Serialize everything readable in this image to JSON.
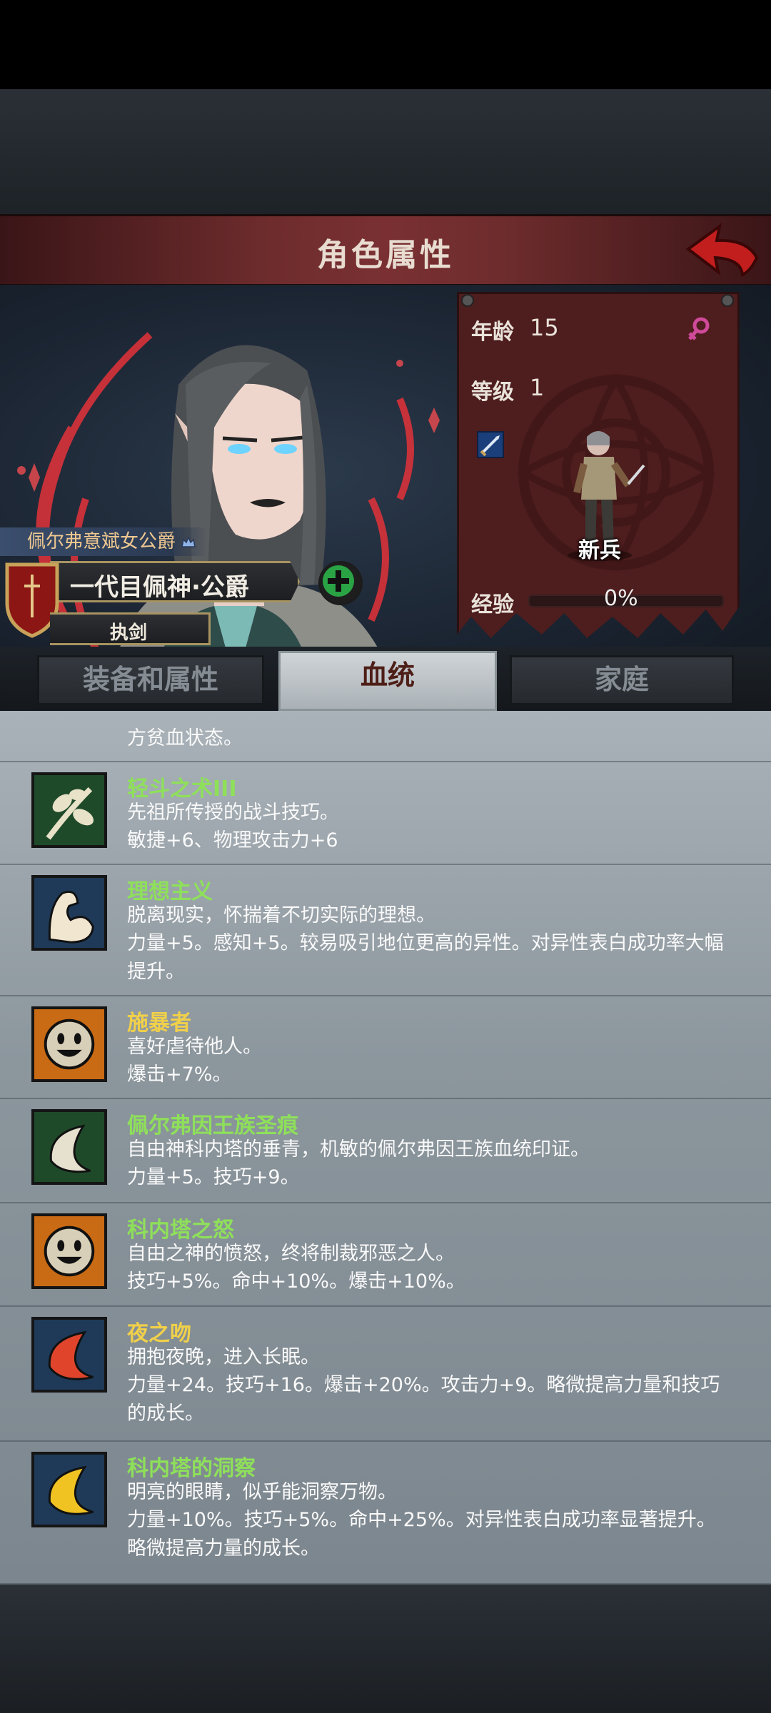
{
  "header": {
    "title": "角色属性"
  },
  "character": {
    "rank_label": "佩尔弗意斌女公爵",
    "name": "一代目佩神·公爵",
    "role": "执剑",
    "class_name": "新兵"
  },
  "stats": {
    "age_label": "年龄",
    "age_value": "15",
    "level_label": "等级",
    "level_value": "1",
    "exp_label": "经验",
    "exp_value": "0%",
    "exp_fraction": 0.0
  },
  "tabs": [
    {
      "label": "装备和属性",
      "active": false
    },
    {
      "label": "血统",
      "active": true
    },
    {
      "label": "家庭",
      "active": false
    }
  ],
  "partial_trait_text": "方贫血状态。",
  "traits": [
    {
      "name": "轻斗之术III",
      "name_color": "#8ee05a",
      "icon": "leaf-branch-icon",
      "icon_bg": "#1f4a2a",
      "description": "先祖所传授的战斗技巧。",
      "effect": "敏捷+6、物理攻击力+6"
    },
    {
      "name": "理想主义",
      "name_color": "#8ee05a",
      "icon": "flexed-arm-icon",
      "icon_bg": "#1e3a58",
      "description": "脱离现实，怀揣着不切实际的理想。",
      "effect": "力量+5。感知+5。较易吸引地位更高的异性。对异性表白成功率大幅提升。"
    },
    {
      "name": "施暴者",
      "name_color": "#f0d04a",
      "icon": "smiley-face-icon",
      "icon_bg": "#c96a14",
      "description": "喜好虐待他人。",
      "effect": "爆击+7%。"
    },
    {
      "name": "佩尔弗因王族圣痕",
      "name_color": "#8ee05a",
      "icon": "white-crescent-icon",
      "icon_bg": "#1f4a2a",
      "description": "自由神科内塔的垂青，机敏的佩尔弗因王族血统印证。",
      "effect": "力量+5。技巧+9。"
    },
    {
      "name": "科内塔之怒",
      "name_color": "#8ee05a",
      "icon": "smiley-face-icon",
      "icon_bg": "#c96a14",
      "description": "自由之神的愤怒，终将制裁邪恶之人。",
      "effect": "技巧+5%。命中+10%。爆击+10%。"
    },
    {
      "name": "夜之吻",
      "name_color": "#f0d04a",
      "icon": "red-crescent-icon",
      "icon_bg": "#1e3a58",
      "description": "拥抱夜晚，进入长眠。",
      "effect": "力量+24。技巧+16。爆击+20%。攻击力+9。略微提高力量和技巧的成长。"
    },
    {
      "name": "科内塔的洞察",
      "name_color": "#8ee05a",
      "icon": "yellow-crescent-icon",
      "icon_bg": "#1e3a58",
      "description": "明亮的眼睛，似乎能洞察万物。",
      "effect": "力量+10%。技巧+5%。命中+25%。对异性表白成功率显著提升。略微提高力量的成长。"
    }
  ]
}
